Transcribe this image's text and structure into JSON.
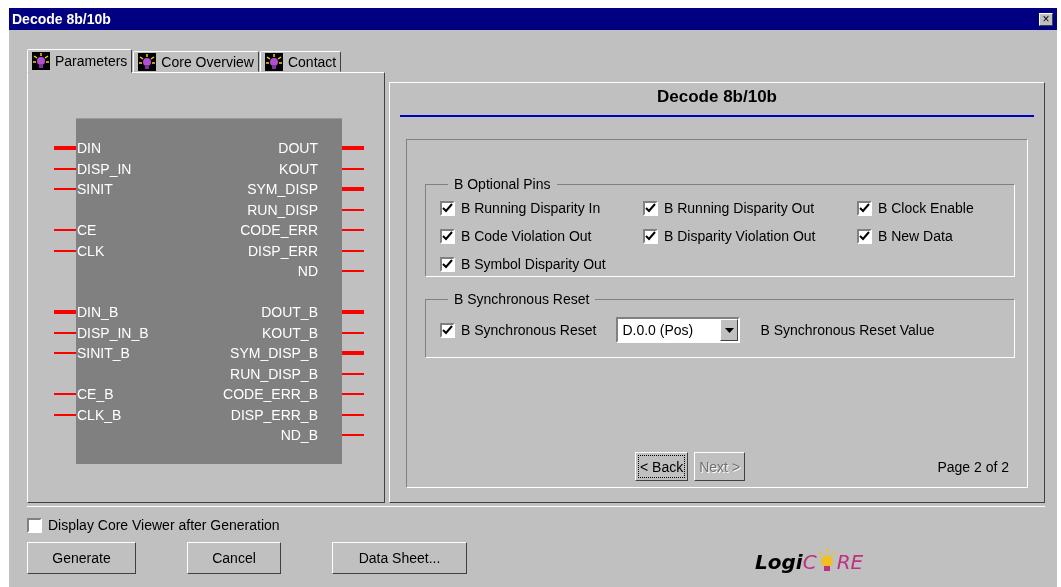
{
  "window": {
    "title": "Decode 8b/10b",
    "close": "×"
  },
  "tabs": [
    {
      "label": "Parameters",
      "selected": true
    },
    {
      "label": "Core Overview",
      "selected": false
    },
    {
      "label": "Contact",
      "selected": false
    }
  ],
  "symbol": {
    "pin_groups": [
      [
        {
          "left": {
            "name": "DIN",
            "bus": true
          },
          "right": {
            "name": "DOUT",
            "bus": true
          }
        },
        {
          "left": {
            "name": "DISP_IN",
            "bus": false
          },
          "right": {
            "name": "KOUT",
            "bus": false
          }
        },
        {
          "left": {
            "name": "SINIT",
            "bus": false
          },
          "right": {
            "name": "SYM_DISP",
            "bus": true
          }
        },
        {
          "right": {
            "name": "RUN_DISP",
            "bus": false
          }
        },
        {
          "left": {
            "name": "CE",
            "bus": false
          },
          "right": {
            "name": "CODE_ERR",
            "bus": false
          }
        },
        {
          "left": {
            "name": "CLK",
            "bus": false
          },
          "right": {
            "name": "DISP_ERR",
            "bus": false
          }
        },
        {
          "right": {
            "name": "ND",
            "bus": false
          }
        }
      ],
      [
        {
          "left": {
            "name": "DIN_B",
            "bus": true
          },
          "right": {
            "name": "DOUT_B",
            "bus": true
          }
        },
        {
          "left": {
            "name": "DISP_IN_B",
            "bus": false
          },
          "right": {
            "name": "KOUT_B",
            "bus": false
          }
        },
        {
          "left": {
            "name": "SINIT_B",
            "bus": false
          },
          "right": {
            "name": "SYM_DISP_B",
            "bus": true
          }
        },
        {
          "right": {
            "name": "RUN_DISP_B",
            "bus": false
          }
        },
        {
          "left": {
            "name": "CE_B",
            "bus": false
          },
          "right": {
            "name": "CODE_ERR_B",
            "bus": false
          }
        },
        {
          "left": {
            "name": "CLK_B",
            "bus": false
          },
          "right": {
            "name": "DISP_ERR_B",
            "bus": false
          }
        },
        {
          "right": {
            "name": "ND_B",
            "bus": false
          }
        }
      ]
    ]
  },
  "page": {
    "title": "Decode 8b/10b",
    "optional_pins": {
      "legend": "B Optional Pins",
      "options": [
        {
          "label": "B Running Disparity In",
          "checked": true
        },
        {
          "label": "B Running Disparity Out",
          "checked": true
        },
        {
          "label": "B Clock Enable",
          "checked": true
        },
        {
          "label": "B Code Violation Out",
          "checked": true
        },
        {
          "label": "B Disparity Violation Out",
          "checked": true
        },
        {
          "label": "B New Data",
          "checked": true
        },
        {
          "label": "B Symbol Disparity Out",
          "checked": true
        }
      ]
    },
    "sync_reset": {
      "legend": "B Synchronous Reset",
      "option": {
        "label": "B Synchronous Reset",
        "checked": true
      },
      "value": "D.0.0 (Pos)",
      "value_label": "B Synchronous Reset Value"
    },
    "back": {
      "label": "< Back",
      "disabled": false
    },
    "next": {
      "label": "Next >",
      "disabled": true
    },
    "page_indicator": "Page 2 of 2"
  },
  "display_viewer": {
    "label": "Display Core Viewer after Generation",
    "checked": false
  },
  "buttons": [
    "Generate",
    "Cancel",
    "Data Sheet..."
  ],
  "logo": {
    "parts": [
      "Logi",
      "C",
      "RE"
    ]
  }
}
